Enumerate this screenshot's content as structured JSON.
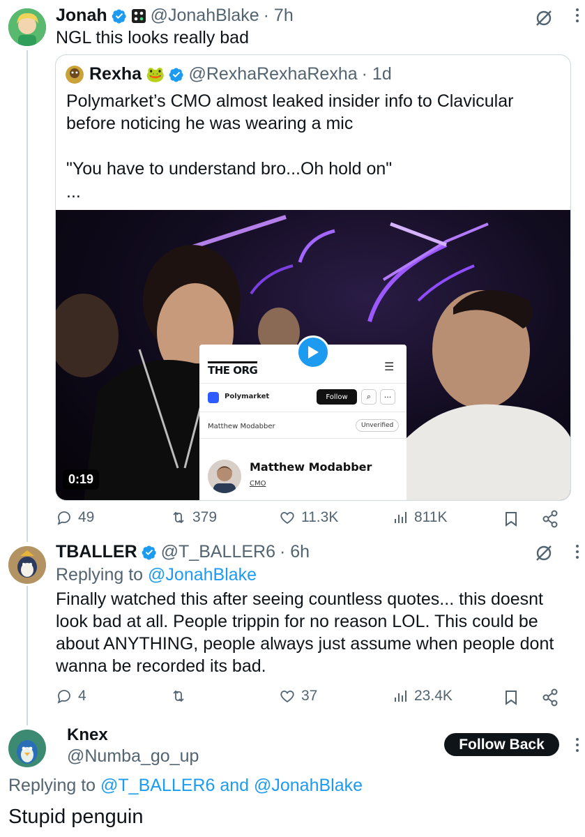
{
  "tweet1": {
    "name": "Jonah",
    "handle": "@JonahBlake",
    "time": "· 7h",
    "text": "NGL this looks really bad"
  },
  "quote": {
    "name": "Rexha",
    "name_emoji": "🐸",
    "handle": "@RexhaRexhaRexha",
    "time": "· 1d",
    "line1": "Polymarket’s CMO almost leaked insider info to Clavicular",
    "line2": "before noticing he was wearing a mic",
    "line3": "\"You have to understand bro...Oh hold on\"",
    "line4": "...",
    "video": {
      "duration": "0:19",
      "org_logo": "THE ORG",
      "company": "Polymarket",
      "follow_label": "Follow",
      "person_tab": "Matthew Modabber",
      "unverified_label": "Unverified",
      "person_name": "Matthew Modabber",
      "person_role": "CMO"
    }
  },
  "tweet1_actions": {
    "replies": "49",
    "reposts": "379",
    "likes": "11.3K",
    "views": "811K"
  },
  "tweet2": {
    "name": "TBALLER",
    "handle": "@T_BALLER6",
    "time": "· 6h",
    "replying_prefix": "Replying to",
    "replying_to": "@JonahBlake",
    "line1": "Finally watched this after seeing countless quotes... this doesnt",
    "line2": "look bad at all. People trippin for no reason LOL. This could be",
    "line3": "about ANYTHING, people always just assume when people dont",
    "line4": "wanna be recorded its bad."
  },
  "tweet2_actions": {
    "replies": "4",
    "reposts": "",
    "likes": "37",
    "views": "23.4K"
  },
  "tweet3": {
    "name": "Knex",
    "handle": "@Numba_go_up",
    "follow_back_label": "Follow Back",
    "replying_prefix": "Replying to",
    "replying_to_1": "@T_BALLER6",
    "replying_and": "and",
    "replying_to_2": "@JonahBlake",
    "text": "Stupid penguin"
  },
  "colors": {
    "accent": "#1d9bf0",
    "text": "#0f1419",
    "secondary": "#536471",
    "verified": "#1d9bf0"
  }
}
